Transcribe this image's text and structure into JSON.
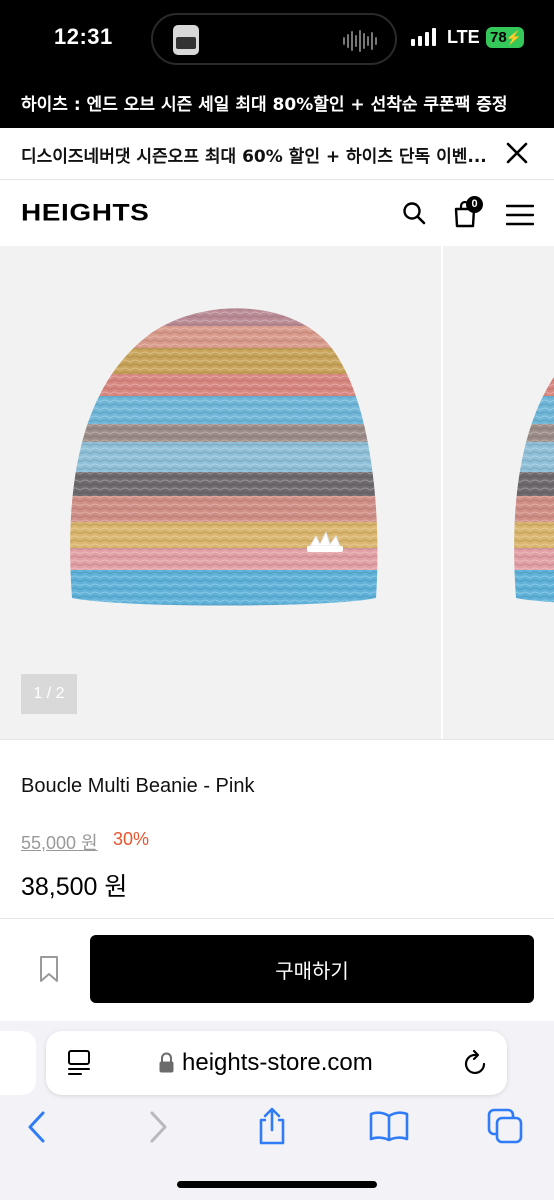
{
  "status_bar": {
    "time": "12:31",
    "network": "LTE",
    "battery": "78"
  },
  "promo_banner": {
    "text": "하이츠 : 엔드 오브 시즌 세일 최대 80%할인 + 선착순 쿠폰팩 증정"
  },
  "notice_bar": {
    "text": "디스이즈네버댓 시즌오프 최대 60% 할인 + 하이츠 단독 이벤..."
  },
  "header": {
    "logo": "HEIGHTS",
    "cart_count": "0"
  },
  "gallery": {
    "counter": "1 / 2"
  },
  "product": {
    "name": "Boucle Multi Beanie - Pink",
    "original_price": "55,000 원",
    "discount": "30%",
    "sale_price": "38,500 원"
  },
  "actions": {
    "buy_label": "구매하기"
  },
  "browser": {
    "url": "heights-store.com"
  },
  "colors": {
    "discount": "#e8542c",
    "battery": "#34c759",
    "safari_blue": "#2f7cf6"
  }
}
